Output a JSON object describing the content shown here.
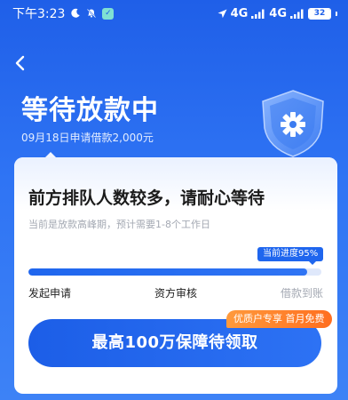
{
  "status_bar": {
    "time": "下午3:23",
    "network_1": "4G",
    "network_2": "4G",
    "battery": "32"
  },
  "header": {
    "title": "等待放款中",
    "subtitle": "09月18日申请借款2,000元"
  },
  "card": {
    "title": "前方排队人数较多，请耐心等待",
    "description": "当前是放款高峰期，预计需要1-8个工作日",
    "progress_label": "当前进度95%",
    "progress_value": 95,
    "steps": [
      {
        "label": "发起申请",
        "done": true
      },
      {
        "label": "资方审核",
        "done": true
      },
      {
        "label": "借款到账",
        "done": false
      }
    ],
    "promo_tag": "优质户专享 首月免费",
    "claim_button": "最高100万保障待领取"
  },
  "colors": {
    "primary": "#1f66ee",
    "promo": "#ff7a2a",
    "muted_text": "#a4a9b3"
  },
  "icons": [
    "moon-icon",
    "bell-off-icon",
    "app-badge-icon",
    "location-arrow-icon",
    "signal-icon",
    "battery-icon",
    "back-chevron-icon",
    "shield-icon"
  ]
}
